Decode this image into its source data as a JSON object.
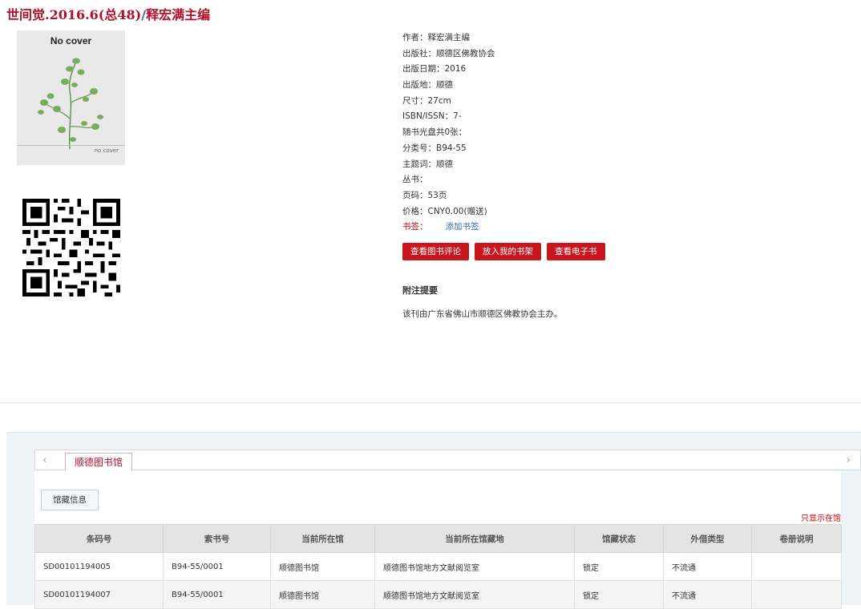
{
  "header": {
    "title_main": "世间觉.2016.6(总48)",
    "separator": "/",
    "title_author": "释宏满主编"
  },
  "cover": {
    "label": "No cover",
    "small_label": "no cover"
  },
  "qr_icon": "qr-code-icon",
  "info": [
    {
      "label": "作者：",
      "value": "释宏满主编"
    },
    {
      "label": "出版社：",
      "value": "顺德区佛教协会"
    },
    {
      "label": "出版日期：",
      "value": "2016"
    },
    {
      "label": "出版地：",
      "value": "顺德"
    },
    {
      "label": "尺寸：",
      "value": "27cm"
    },
    {
      "label": "ISBN/ISSN：",
      "value": "7-"
    },
    {
      "label": "随书光盘共0张：",
      "value": ""
    },
    {
      "label": "分类号：",
      "value": "B94-55"
    },
    {
      "label": "主题词：",
      "value": "顺德"
    },
    {
      "label": "丛书：",
      "value": ""
    },
    {
      "label": "页码：",
      "value": "53页"
    },
    {
      "label": "价格：",
      "value": "CNY0.00(赠送)"
    }
  ],
  "bookmark": {
    "label": "书签：",
    "link": "添加书签"
  },
  "buttons": [
    "查看图书评论",
    "放入我的书架",
    "查看电子书"
  ],
  "note": {
    "heading": "附注提要",
    "text": "该刊由广东省佛山市顺德区佛教协会主办。"
  },
  "holdings": {
    "tab_label": "顺德图书馆",
    "subtab_label": "馆藏信息",
    "only_show": "只显示在馆",
    "columns": [
      "条码号",
      "索书号",
      "当前所在馆",
      "当前所在馆藏地",
      "馆藏状态",
      "外借类型",
      "卷册说明"
    ],
    "rows": [
      [
        "SD00101194005",
        "B94-55/0001",
        "顺德图书馆",
        "顺德图书馆地方文献阅览室",
        "锁定",
        "不流通",
        ""
      ],
      [
        "SD00101194007",
        "B94-55/0001",
        "顺德图书馆",
        "顺德图书馆地方文献阅览室",
        "锁定",
        "不流通",
        ""
      ]
    ]
  },
  "colors": {
    "accent": "#c8161e",
    "title": "#b0102a",
    "link": "#2b6fb5"
  }
}
